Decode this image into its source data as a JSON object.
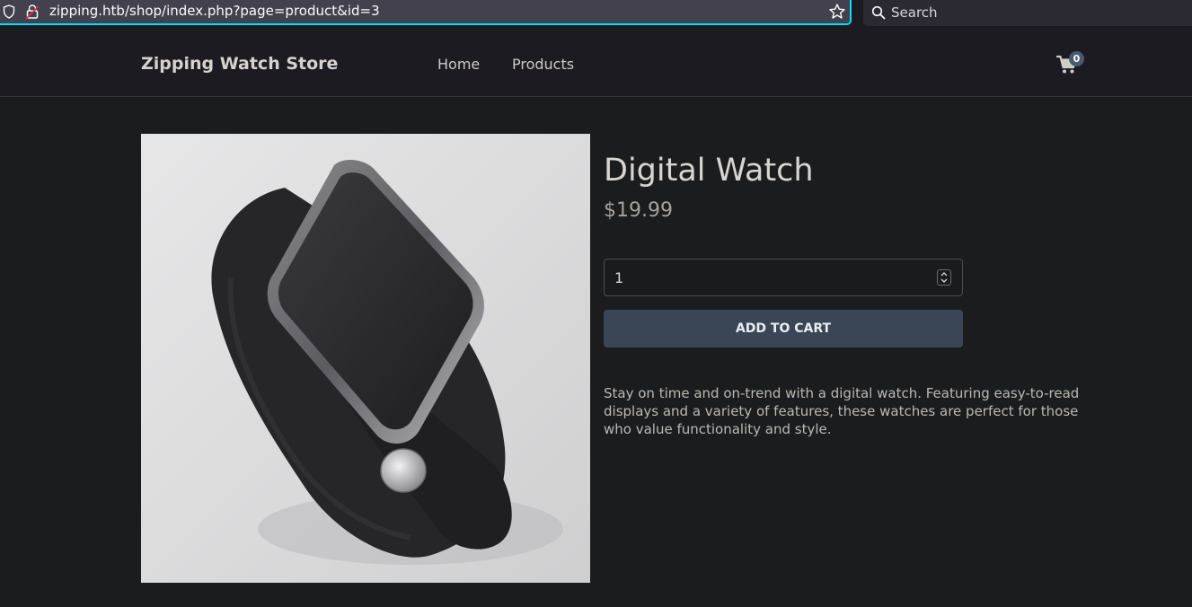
{
  "browser": {
    "url": "zipping.htb/shop/index.php?page=product&id=3",
    "search_placeholder": "Search",
    "accent": "#00ddff"
  },
  "header": {
    "brand": "Zipping Watch Store",
    "nav": {
      "home": "Home",
      "products": "Products"
    },
    "cart_count": "0"
  },
  "product": {
    "title": "Digital Watch",
    "price": "$19.99",
    "quantity": "1",
    "add_to_cart_label": "ADD TO CART",
    "description": "Stay on time and on-trend with a digital watch. Featuring easy-to-read displays and a variety of features, these watches are perfect for those who value functionality and style."
  },
  "colors": {
    "page_bg": "#1b1c1e",
    "button_bg": "#3a4656",
    "badge_bg": "#4a5a6e"
  }
}
